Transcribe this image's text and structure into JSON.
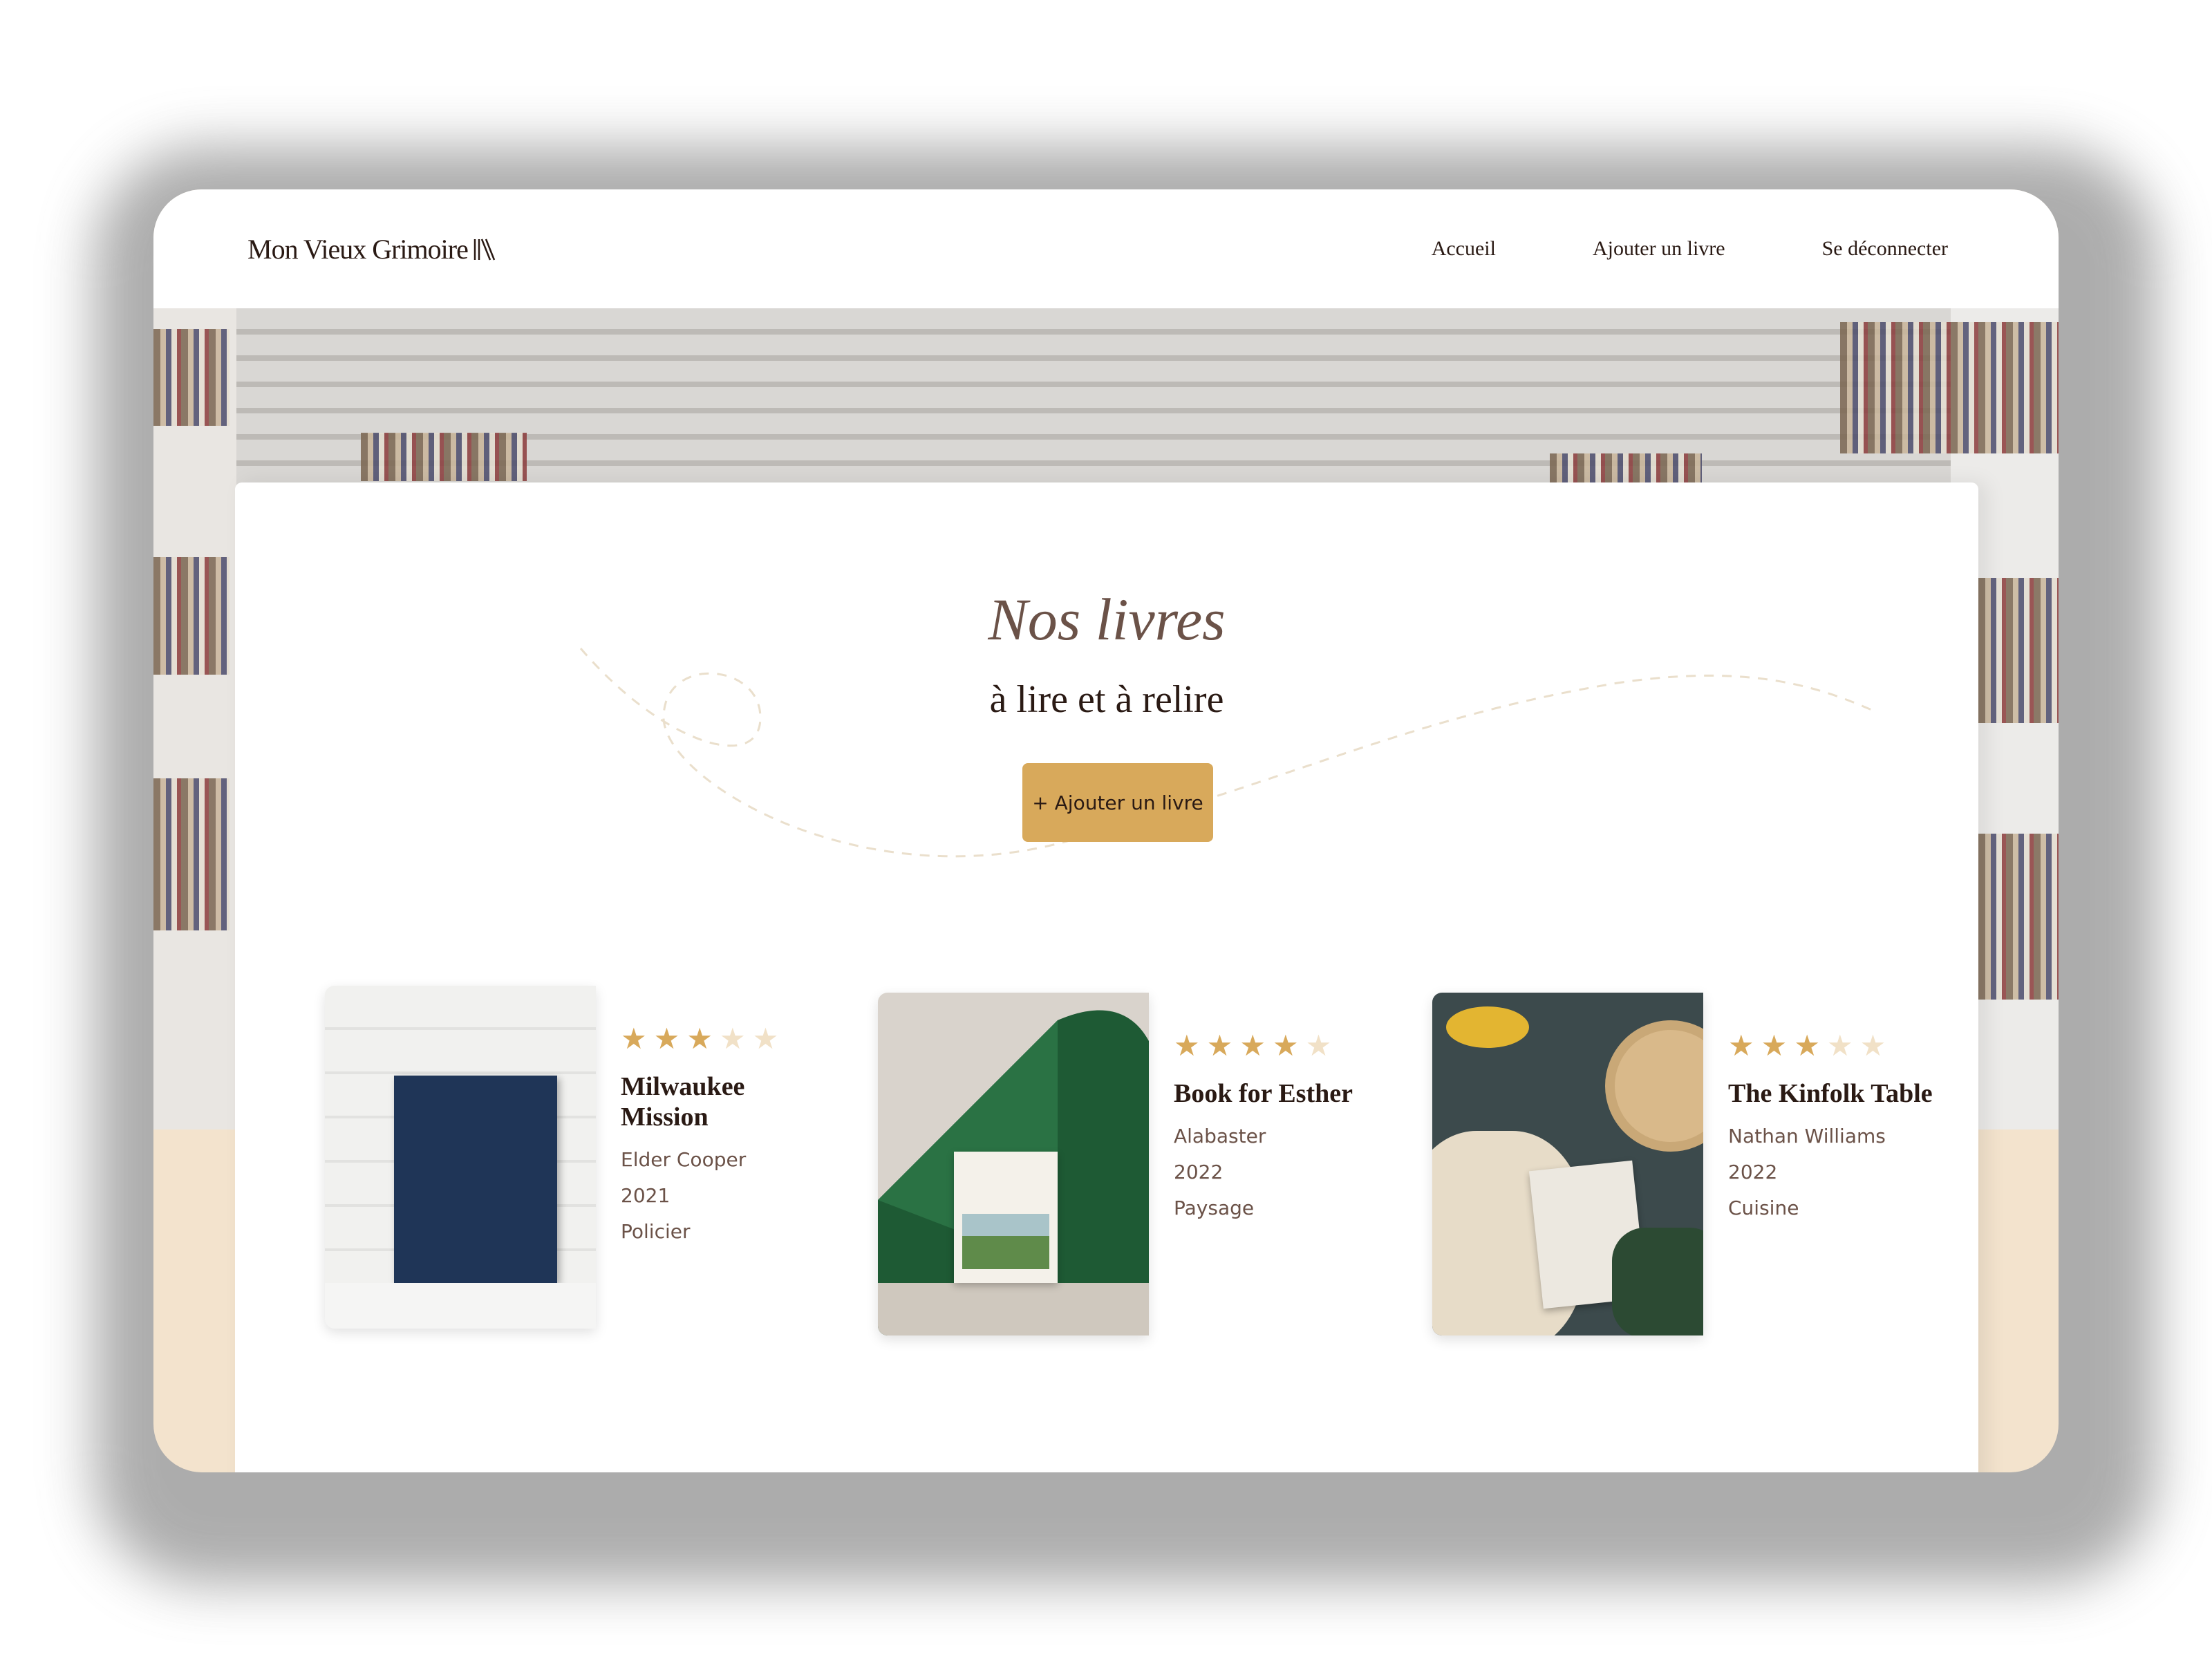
{
  "header": {
    "logo_text": "Mon Vieux Grimoire",
    "nav": [
      "Accueil",
      "Ajouter un livre",
      "Se déconnecter"
    ]
  },
  "hero": {
    "title": "Nos livres",
    "subtitle": "à lire et à relire",
    "add_button_label": "+ Ajouter un livre"
  },
  "books": [
    {
      "title": "Milwaukee Mission",
      "author": "Elder Cooper",
      "year": "2021",
      "genre": "Policier",
      "rating": 3,
      "cover": "blue-hardcover-book-image"
    },
    {
      "title": "Book for Esther",
      "author": "Alabaster",
      "year": "2022",
      "genre": "Paysage",
      "rating": 4,
      "cover": "esther-book-green-paper-image"
    },
    {
      "title": "The Kinfolk Table",
      "author": "Nathan Williams",
      "year": "2022",
      "genre": "Cuisine",
      "rating": 3,
      "cover": "kinfolk-table-flatlay-image"
    }
  ],
  "colors": {
    "accent": "#d8a95b",
    "title_brown": "#6b5248",
    "text_dark": "#2a1a14",
    "star_empty": "#f1e1c7",
    "page_beige": "#f3e3cd"
  }
}
